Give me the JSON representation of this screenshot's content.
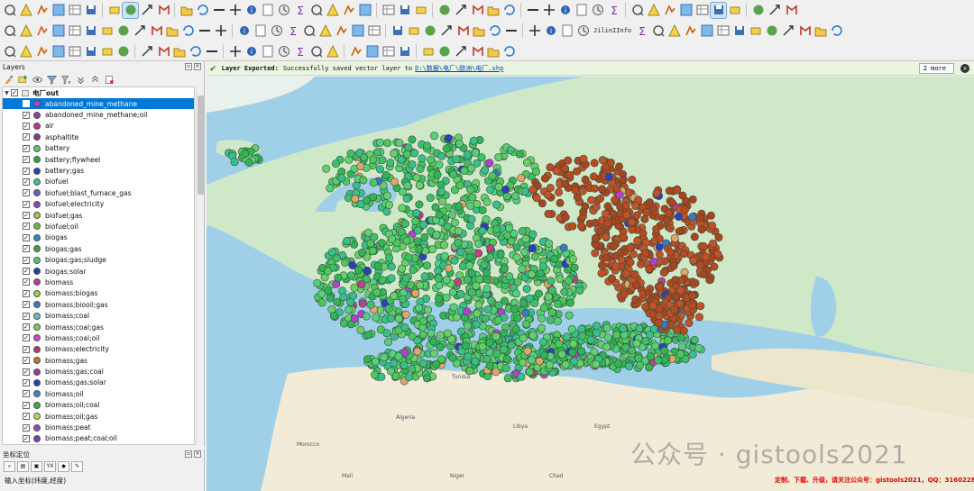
{
  "toolbar": {
    "plugin_label": "JilinIInfo"
  },
  "layers_panel": {
    "title": "Layers",
    "group_name": "电厂out",
    "items": [
      {
        "label": "abandoned_mine_methane",
        "color": "#b43fd0",
        "selected": true
      },
      {
        "label": "abandoned_mine_methane;oil",
        "color": "#8e3ea8"
      },
      {
        "label": "air",
        "color": "#c2338a"
      },
      {
        "label": "asphaltite",
        "color": "#8a3b86"
      },
      {
        "label": "battery",
        "color": "#5ec47a"
      },
      {
        "label": "battery;flywheel",
        "color": "#2ea63a"
      },
      {
        "label": "battery;gas",
        "color": "#2b3fbf"
      },
      {
        "label": "biofuel",
        "color": "#3ec28f"
      },
      {
        "label": "biofuel;blast_furnace_gas",
        "color": "#6e5bbd"
      },
      {
        "label": "biofuel;electricity",
        "color": "#8844c0"
      },
      {
        "label": "biofuel;gas",
        "color": "#9acb3c"
      },
      {
        "label": "biofuel;oil",
        "color": "#73b93a"
      },
      {
        "label": "biogas",
        "color": "#2e8ab8"
      },
      {
        "label": "biogas;gas",
        "color": "#4f9e3f"
      },
      {
        "label": "biogas;gas;sludge",
        "color": "#52c47c"
      },
      {
        "label": "biogas;solar",
        "color": "#1f3ea8"
      },
      {
        "label": "biomass",
        "color": "#c03e8c"
      },
      {
        "label": "biomass;biogas",
        "color": "#96cf45"
      },
      {
        "label": "biomass;biooil;gas",
        "color": "#3a78c4"
      },
      {
        "label": "biomass;coal",
        "color": "#58c3c0"
      },
      {
        "label": "biomass;coal;gas",
        "color": "#7bcc5a"
      },
      {
        "label": "biomass;coal;oil",
        "color": "#c64fd0"
      },
      {
        "label": "biomass;electricity",
        "color": "#b8336b"
      },
      {
        "label": "biomass;gas",
        "color": "#b47b2e"
      },
      {
        "label": "biomass;gas;coal",
        "color": "#a7338d"
      },
      {
        "label": "biomass;gas;solar",
        "color": "#2441b3"
      },
      {
        "label": "biomass;oil",
        "color": "#3b85c8"
      },
      {
        "label": "biomass;oil;coal",
        "color": "#3aaa4a"
      },
      {
        "label": "biomass;oil;gas",
        "color": "#b6d25a"
      },
      {
        "label": "biomass;peat",
        "color": "#8d4cc2"
      },
      {
        "label": "biomass;peat;coal;oil",
        "color": "#7a3ec4"
      }
    ]
  },
  "coord_panel": {
    "title": "坐标定位",
    "input_label": "输入坐标(纬度,经度)"
  },
  "message_bar": {
    "title": "Layer Exported:",
    "text": "Successfully saved vector layer to",
    "link": "D:\\数据\\电厂\\欧洲\\电厂.shp",
    "more_label": "2 more",
    "close_icon": "close-icon"
  },
  "map": {
    "place_labels": [
      "Tunisia",
      "Algeria",
      "Libya",
      "Egypt",
      "Morocco",
      "Mali",
      "Niger",
      "Chad"
    ],
    "watermark": "公众号 · gistools2021",
    "promo_text": "定制、下载、升级，请关注公众号：gistools2021，QQ：316022856"
  },
  "colors": {
    "selection": "#0078d7",
    "sea": "#9fd0e8",
    "point_green": "#4cc95c",
    "point_rust": "#b84a22",
    "point_blue": "#2b3fbf"
  }
}
